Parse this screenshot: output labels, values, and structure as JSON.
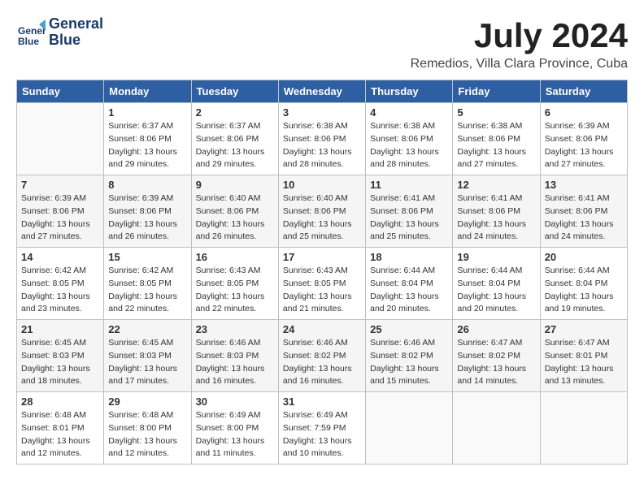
{
  "header": {
    "logo_line1": "General",
    "logo_line2": "Blue",
    "month_year": "July 2024",
    "location": "Remedios, Villa Clara Province, Cuba"
  },
  "days_of_week": [
    "Sunday",
    "Monday",
    "Tuesday",
    "Wednesday",
    "Thursday",
    "Friday",
    "Saturday"
  ],
  "weeks": [
    [
      {
        "day": "",
        "empty": true
      },
      {
        "day": "1",
        "sunrise": "6:37 AM",
        "sunset": "8:06 PM",
        "daylight": "13 hours and 29 minutes."
      },
      {
        "day": "2",
        "sunrise": "6:37 AM",
        "sunset": "8:06 PM",
        "daylight": "13 hours and 29 minutes."
      },
      {
        "day": "3",
        "sunrise": "6:38 AM",
        "sunset": "8:06 PM",
        "daylight": "13 hours and 28 minutes."
      },
      {
        "day": "4",
        "sunrise": "6:38 AM",
        "sunset": "8:06 PM",
        "daylight": "13 hours and 28 minutes."
      },
      {
        "day": "5",
        "sunrise": "6:38 AM",
        "sunset": "8:06 PM",
        "daylight": "13 hours and 27 minutes."
      },
      {
        "day": "6",
        "sunrise": "6:39 AM",
        "sunset": "8:06 PM",
        "daylight": "13 hours and 27 minutes."
      }
    ],
    [
      {
        "day": "7",
        "sunrise": "6:39 AM",
        "sunset": "8:06 PM",
        "daylight": "13 hours and 27 minutes."
      },
      {
        "day": "8",
        "sunrise": "6:39 AM",
        "sunset": "8:06 PM",
        "daylight": "13 hours and 26 minutes."
      },
      {
        "day": "9",
        "sunrise": "6:40 AM",
        "sunset": "8:06 PM",
        "daylight": "13 hours and 26 minutes."
      },
      {
        "day": "10",
        "sunrise": "6:40 AM",
        "sunset": "8:06 PM",
        "daylight": "13 hours and 25 minutes."
      },
      {
        "day": "11",
        "sunrise": "6:41 AM",
        "sunset": "8:06 PM",
        "daylight": "13 hours and 25 minutes."
      },
      {
        "day": "12",
        "sunrise": "6:41 AM",
        "sunset": "8:06 PM",
        "daylight": "13 hours and 24 minutes."
      },
      {
        "day": "13",
        "sunrise": "6:41 AM",
        "sunset": "8:06 PM",
        "daylight": "13 hours and 24 minutes."
      }
    ],
    [
      {
        "day": "14",
        "sunrise": "6:42 AM",
        "sunset": "8:05 PM",
        "daylight": "13 hours and 23 minutes."
      },
      {
        "day": "15",
        "sunrise": "6:42 AM",
        "sunset": "8:05 PM",
        "daylight": "13 hours and 22 minutes."
      },
      {
        "day": "16",
        "sunrise": "6:43 AM",
        "sunset": "8:05 PM",
        "daylight": "13 hours and 22 minutes."
      },
      {
        "day": "17",
        "sunrise": "6:43 AM",
        "sunset": "8:05 PM",
        "daylight": "13 hours and 21 minutes."
      },
      {
        "day": "18",
        "sunrise": "6:44 AM",
        "sunset": "8:04 PM",
        "daylight": "13 hours and 20 minutes."
      },
      {
        "day": "19",
        "sunrise": "6:44 AM",
        "sunset": "8:04 PM",
        "daylight": "13 hours and 20 minutes."
      },
      {
        "day": "20",
        "sunrise": "6:44 AM",
        "sunset": "8:04 PM",
        "daylight": "13 hours and 19 minutes."
      }
    ],
    [
      {
        "day": "21",
        "sunrise": "6:45 AM",
        "sunset": "8:03 PM",
        "daylight": "13 hours and 18 minutes."
      },
      {
        "day": "22",
        "sunrise": "6:45 AM",
        "sunset": "8:03 PM",
        "daylight": "13 hours and 17 minutes."
      },
      {
        "day": "23",
        "sunrise": "6:46 AM",
        "sunset": "8:03 PM",
        "daylight": "13 hours and 16 minutes."
      },
      {
        "day": "24",
        "sunrise": "6:46 AM",
        "sunset": "8:02 PM",
        "daylight": "13 hours and 16 minutes."
      },
      {
        "day": "25",
        "sunrise": "6:46 AM",
        "sunset": "8:02 PM",
        "daylight": "13 hours and 15 minutes."
      },
      {
        "day": "26",
        "sunrise": "6:47 AM",
        "sunset": "8:02 PM",
        "daylight": "13 hours and 14 minutes."
      },
      {
        "day": "27",
        "sunrise": "6:47 AM",
        "sunset": "8:01 PM",
        "daylight": "13 hours and 13 minutes."
      }
    ],
    [
      {
        "day": "28",
        "sunrise": "6:48 AM",
        "sunset": "8:01 PM",
        "daylight": "13 hours and 12 minutes."
      },
      {
        "day": "29",
        "sunrise": "6:48 AM",
        "sunset": "8:00 PM",
        "daylight": "13 hours and 12 minutes."
      },
      {
        "day": "30",
        "sunrise": "6:49 AM",
        "sunset": "8:00 PM",
        "daylight": "13 hours and 11 minutes."
      },
      {
        "day": "31",
        "sunrise": "6:49 AM",
        "sunset": "7:59 PM",
        "daylight": "13 hours and 10 minutes."
      },
      {
        "day": "",
        "empty": true
      },
      {
        "day": "",
        "empty": true
      },
      {
        "day": "",
        "empty": true
      }
    ]
  ]
}
